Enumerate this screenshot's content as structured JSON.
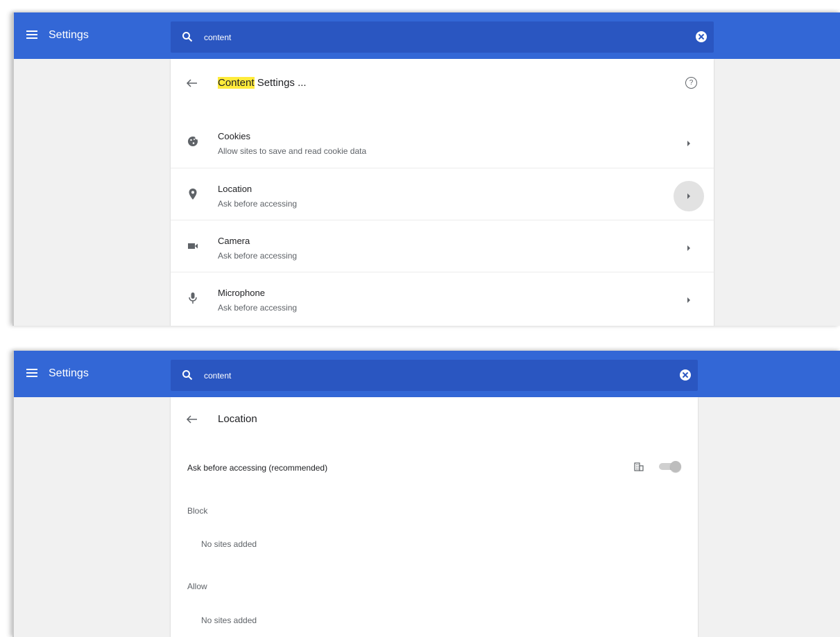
{
  "colors": {
    "accent": "#3367d6",
    "search_bg": "#2a56c1",
    "highlight": "#ffeb3b"
  },
  "top": {
    "header": {
      "title": "Settings",
      "search_value": "content"
    },
    "subpage": {
      "title_highlight": "Content",
      "title_rest": " Settings ...",
      "help_icon": "help-icon"
    },
    "rows": [
      {
        "title": "Cookies",
        "subtitle": "Allow sites to save and read cookie data",
        "icon": "cookie-icon"
      },
      {
        "title": "Location",
        "subtitle": "Ask before accessing",
        "icon": "location-pin-icon"
      },
      {
        "title": "Camera",
        "subtitle": "Ask before accessing",
        "icon": "camera-icon"
      },
      {
        "title": "Microphone",
        "subtitle": "Ask before accessing",
        "icon": "microphone-icon"
      }
    ]
  },
  "bottom": {
    "header": {
      "title": "Settings",
      "search_value": "content"
    },
    "subpage": {
      "title": "Location"
    },
    "setting": {
      "label": "Ask before accessing (recommended)",
      "enabled": true
    },
    "block": {
      "label": "Block",
      "empty": "No sites added"
    },
    "allow": {
      "label": "Allow",
      "empty": "No sites added"
    }
  }
}
